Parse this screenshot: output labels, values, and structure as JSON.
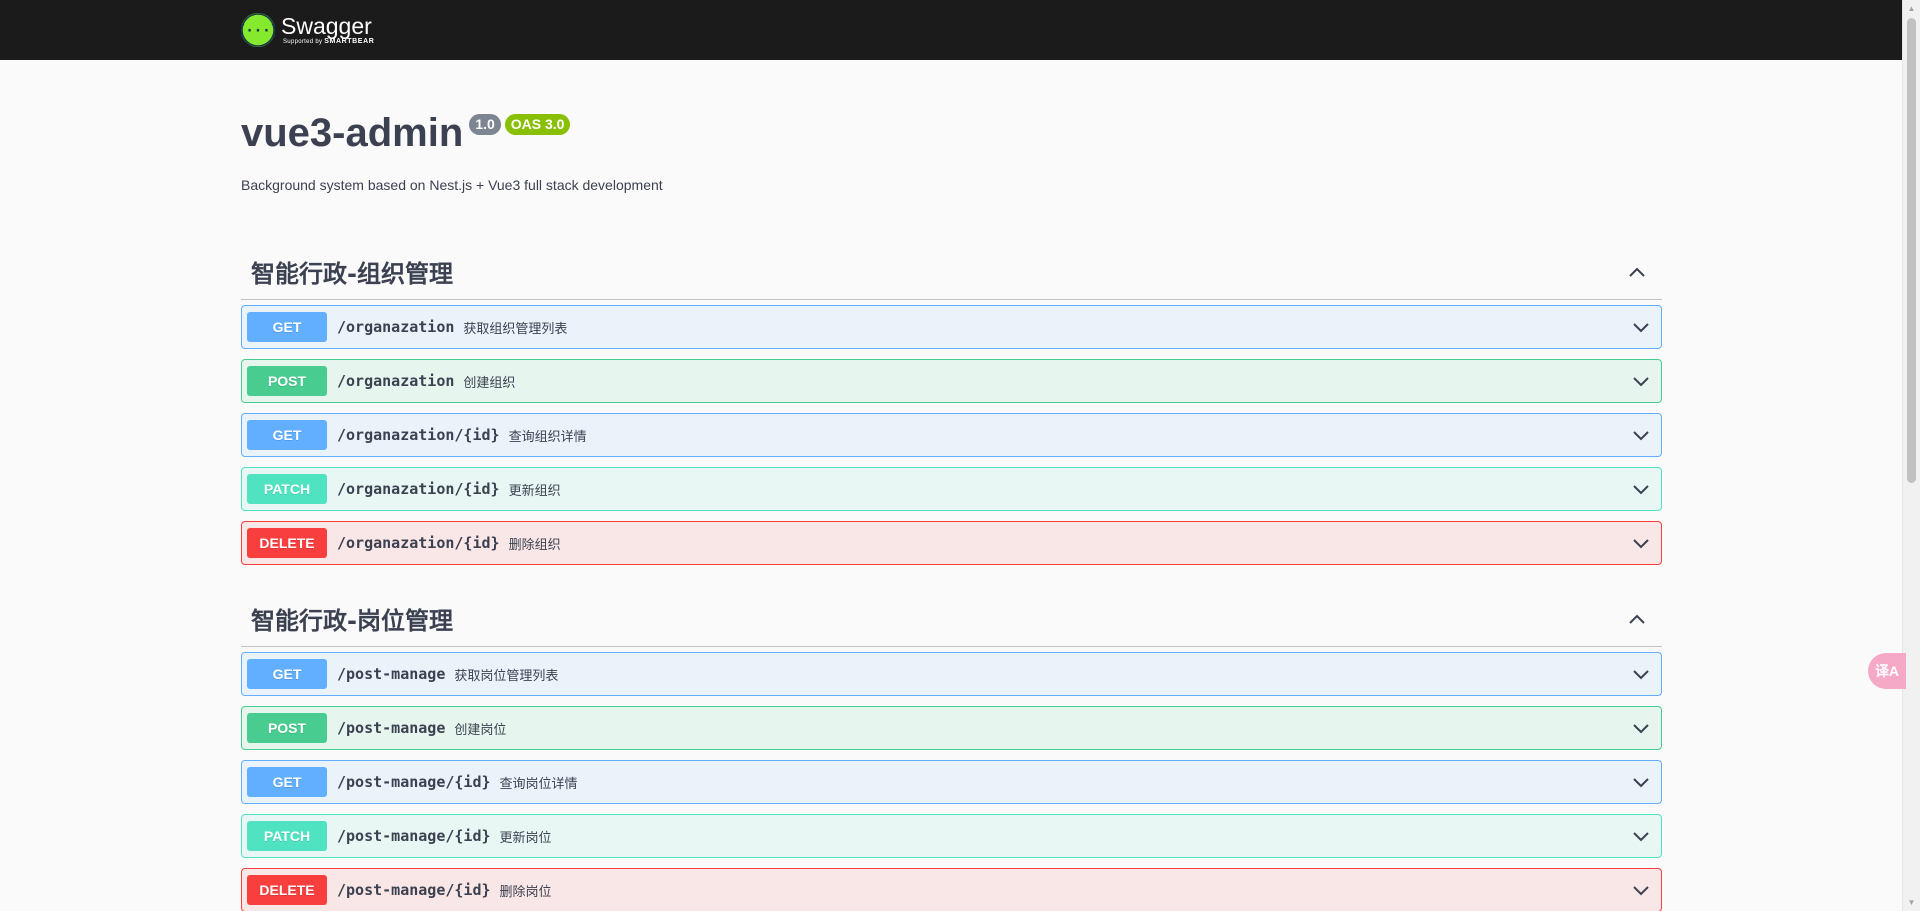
{
  "topbar": {
    "brand": "Swagger",
    "brand_sub": "Supported by",
    "brand_sub_company": "SMARTBEAR",
    "logo_icon": "swagger-logo-icon"
  },
  "info": {
    "title": "vue3-admin",
    "version": "1.0",
    "oas": "OAS 3.0",
    "description": "Background system based on Nest.js + Vue3 full stack development"
  },
  "tags": [
    {
      "name": "智能行政-组织管理",
      "operations": [
        {
          "method": "GET",
          "path": "/organazation",
          "summary": "获取组织管理列表"
        },
        {
          "method": "POST",
          "path": "/organazation",
          "summary": "创建组织"
        },
        {
          "method": "GET",
          "path": "/organazation/{id}",
          "summary": "查询组织详情"
        },
        {
          "method": "PATCH",
          "path": "/organazation/{id}",
          "summary": "更新组织"
        },
        {
          "method": "DELETE",
          "path": "/organazation/{id}",
          "summary": "删除组织"
        }
      ]
    },
    {
      "name": "智能行政-岗位管理",
      "operations": [
        {
          "method": "GET",
          "path": "/post-manage",
          "summary": "获取岗位管理列表"
        },
        {
          "method": "POST",
          "path": "/post-manage",
          "summary": "创建岗位"
        },
        {
          "method": "GET",
          "path": "/post-manage/{id}",
          "summary": "查询岗位详情"
        },
        {
          "method": "PATCH",
          "path": "/post-manage/{id}",
          "summary": "更新岗位"
        },
        {
          "method": "DELETE",
          "path": "/post-manage/{id}",
          "summary": "删除岗位"
        }
      ]
    }
  ],
  "colors": {
    "get": "#61affe",
    "post": "#49cc90",
    "patch": "#50e3c2",
    "delete": "#f93e3e",
    "topbar": "#1b1b1b",
    "brand_green": "#85ea2d"
  },
  "widget": {
    "translate_icon": "translate-icon",
    "glyph": "译A"
  }
}
